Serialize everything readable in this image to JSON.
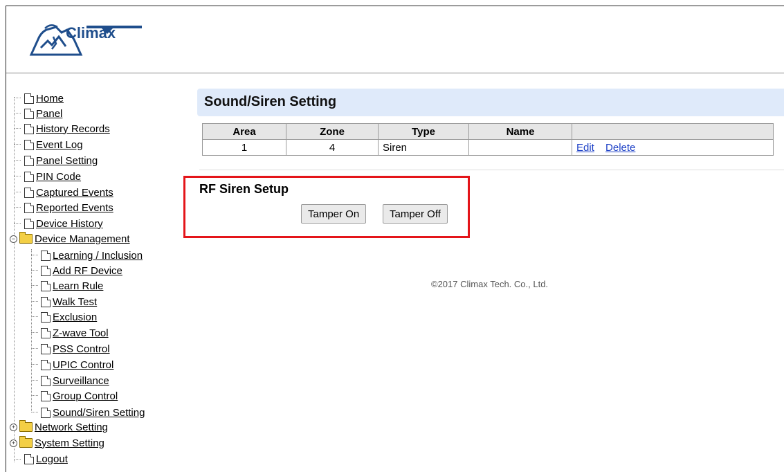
{
  "brand": {
    "name": "Climax"
  },
  "tree": {
    "items": [
      {
        "label": "Home",
        "type": "page"
      },
      {
        "label": "Panel",
        "type": "page"
      },
      {
        "label": "History Records",
        "type": "page"
      },
      {
        "label": "Event Log",
        "type": "page"
      },
      {
        "label": "Panel Setting",
        "type": "page"
      },
      {
        "label": "PIN Code",
        "type": "page"
      },
      {
        "label": "Captured Events",
        "type": "page"
      },
      {
        "label": "Reported Events",
        "type": "page"
      },
      {
        "label": "Device History",
        "type": "page"
      },
      {
        "label": "Device Management",
        "type": "folder",
        "toggle": "−"
      },
      {
        "label": "Learning / Inclusion",
        "type": "page"
      },
      {
        "label": "Add RF Device",
        "type": "page"
      },
      {
        "label": "Learn Rule",
        "type": "page"
      },
      {
        "label": "Walk Test",
        "type": "page"
      },
      {
        "label": "Exclusion",
        "type": "page"
      },
      {
        "label": "Z-wave Tool",
        "type": "page"
      },
      {
        "label": "PSS Control",
        "type": "page"
      },
      {
        "label": "UPIC Control",
        "type": "page"
      },
      {
        "label": "Surveillance",
        "type": "page"
      },
      {
        "label": "Group Control",
        "type": "page"
      },
      {
        "label": "Sound/Siren Setting",
        "type": "page"
      },
      {
        "label": "Network Setting",
        "type": "folder",
        "toggle": "+"
      },
      {
        "label": "System Setting",
        "type": "folder",
        "toggle": "+"
      },
      {
        "label": "Logout",
        "type": "page"
      }
    ]
  },
  "main": {
    "title": "Sound/Siren Setting",
    "table": {
      "headers": [
        "Area",
        "Zone",
        "Type",
        "Name",
        ""
      ],
      "rows": [
        {
          "area": "1",
          "zone": "4",
          "type": "Siren",
          "name": "",
          "edit": "Edit",
          "delete": "Delete"
        }
      ]
    },
    "rf_siren": {
      "title": "RF Siren Setup",
      "tamper_on": "Tamper On",
      "tamper_off": "Tamper Off"
    },
    "footer": "©2017 Climax Tech. Co., Ltd."
  },
  "colors": {
    "highlight_box": "#e4151a",
    "title_bar": "#dfeafa",
    "link": "#1b3fc6"
  }
}
